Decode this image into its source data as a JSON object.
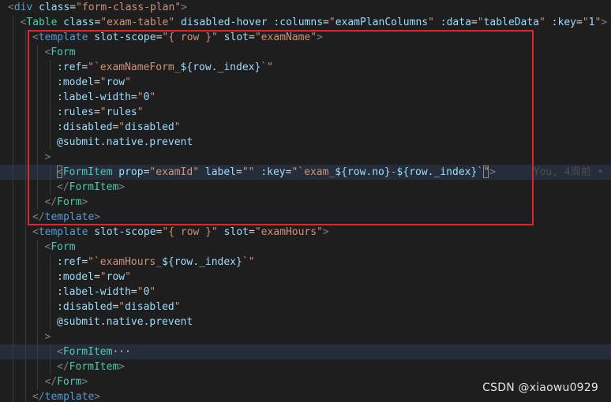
{
  "editor": {
    "theme": {
      "background": "#1e1e1e",
      "current_line": "#262d3a",
      "html_tag": "#569cd6",
      "component_tag": "#4ec9b0",
      "attribute": "#9cdcfe",
      "string": "#ce9178",
      "punctuation": "#808080",
      "highlight_box": "#e0262d"
    },
    "lines": [
      {
        "indent": 0,
        "tokens": [
          [
            "tag-bracket",
            "<"
          ],
          [
            "html-tag",
            "div"
          ],
          [
            "eq",
            " "
          ],
          [
            "attr",
            "class"
          ],
          [
            "eq",
            "="
          ],
          [
            "str",
            "\"form-class-plan\""
          ],
          [
            "tag-bracket",
            ">"
          ]
        ]
      },
      {
        "indent": 1,
        "tokens": [
          [
            "tag-bracket",
            "<"
          ],
          [
            "tag",
            "Table"
          ],
          [
            "eq",
            " "
          ],
          [
            "attr",
            "class"
          ],
          [
            "eq",
            "="
          ],
          [
            "str",
            "\"exam-table\""
          ],
          [
            "eq",
            " "
          ],
          [
            "attr",
            "disabled-hover"
          ],
          [
            "eq",
            " "
          ],
          [
            "attr",
            ":columns"
          ],
          [
            "eq",
            "="
          ],
          [
            "str",
            "\""
          ],
          [
            "bind",
            "examPlanColumns"
          ],
          [
            "str",
            "\""
          ],
          [
            "eq",
            " "
          ],
          [
            "attr",
            ":data"
          ],
          [
            "eq",
            "="
          ],
          [
            "str",
            "\""
          ],
          [
            "bind",
            "tableData"
          ],
          [
            "str",
            "\""
          ],
          [
            "eq",
            " "
          ],
          [
            "attr",
            ":key"
          ],
          [
            "eq",
            "="
          ],
          [
            "str",
            "\""
          ],
          [
            "bind",
            "1"
          ],
          [
            "str",
            "\""
          ],
          [
            "tag-bracket",
            ">"
          ]
        ]
      },
      {
        "indent": 2,
        "tokens": [
          [
            "tag-bracket",
            "<"
          ],
          [
            "html-tag",
            "template"
          ],
          [
            "eq",
            " "
          ],
          [
            "attr",
            "slot-scope"
          ],
          [
            "eq",
            "="
          ],
          [
            "str",
            "\"{ row }\""
          ],
          [
            "eq",
            " "
          ],
          [
            "attr",
            "slot"
          ],
          [
            "eq",
            "="
          ],
          [
            "str",
            "\"examName\""
          ],
          [
            "tag-bracket",
            ">"
          ]
        ]
      },
      {
        "indent": 3,
        "tokens": [
          [
            "tag-bracket",
            "<"
          ],
          [
            "tag",
            "Form"
          ]
        ]
      },
      {
        "indent": 4,
        "tokens": [
          [
            "attr",
            ":ref"
          ],
          [
            "eq",
            "="
          ],
          [
            "str",
            "\"`"
          ],
          [
            "str",
            "examNameForm_"
          ],
          [
            "bind",
            "${row._index}"
          ],
          [
            "str",
            "`\""
          ]
        ]
      },
      {
        "indent": 4,
        "tokens": [
          [
            "attr",
            ":model"
          ],
          [
            "eq",
            "="
          ],
          [
            "str",
            "\""
          ],
          [
            "bind",
            "row"
          ],
          [
            "str",
            "\""
          ]
        ]
      },
      {
        "indent": 4,
        "tokens": [
          [
            "attr",
            ":label-width"
          ],
          [
            "eq",
            "="
          ],
          [
            "str",
            "\""
          ],
          [
            "bind",
            "0"
          ],
          [
            "str",
            "\""
          ]
        ]
      },
      {
        "indent": 4,
        "tokens": [
          [
            "attr",
            ":rules"
          ],
          [
            "eq",
            "="
          ],
          [
            "str",
            "\""
          ],
          [
            "bind",
            "rules"
          ],
          [
            "str",
            "\""
          ]
        ]
      },
      {
        "indent": 4,
        "tokens": [
          [
            "attr",
            ":disabled"
          ],
          [
            "eq",
            "="
          ],
          [
            "str",
            "\""
          ],
          [
            "bind",
            "disabled"
          ],
          [
            "str",
            "\""
          ]
        ]
      },
      {
        "indent": 4,
        "tokens": [
          [
            "attr",
            "@submit.native.prevent"
          ]
        ]
      },
      {
        "indent": 3,
        "tokens": [
          [
            "tag-bracket",
            ">"
          ]
        ]
      },
      {
        "indent": 4,
        "current": true,
        "tokens": [
          [
            "tag-bracket",
            "<"
          ],
          [
            "tag",
            "FormItem"
          ],
          [
            "eq",
            " "
          ],
          [
            "attr",
            "prop"
          ],
          [
            "eq",
            "="
          ],
          [
            "str",
            "\"examId\""
          ],
          [
            "eq",
            " "
          ],
          [
            "attr",
            "label"
          ],
          [
            "eq",
            "="
          ],
          [
            "str",
            "\"\""
          ],
          [
            "eq",
            " "
          ],
          [
            "attr",
            ":key"
          ],
          [
            "eq",
            "="
          ],
          [
            "str",
            "\"`"
          ],
          [
            "str",
            "exam_"
          ],
          [
            "bind",
            "${row.no}"
          ],
          [
            "str",
            "-"
          ],
          [
            "bind",
            "${row._index}"
          ],
          [
            "str",
            "`\""
          ],
          [
            "tag-bracket",
            ">"
          ]
        ],
        "blame": "You, 4周前 • f"
      },
      {
        "indent": 4,
        "tokens": [
          [
            "tag-bracket",
            "</"
          ],
          [
            "tag",
            "FormItem"
          ],
          [
            "tag-bracket",
            ">"
          ]
        ]
      },
      {
        "indent": 3,
        "tokens": [
          [
            "tag-bracket",
            "</"
          ],
          [
            "tag",
            "Form"
          ],
          [
            "tag-bracket",
            ">"
          ]
        ]
      },
      {
        "indent": 2,
        "tokens": [
          [
            "tag-bracket",
            "</"
          ],
          [
            "html-tag",
            "template"
          ],
          [
            "tag-bracket",
            ">"
          ]
        ]
      },
      {
        "indent": 2,
        "tokens": [
          [
            "tag-bracket",
            "<"
          ],
          [
            "html-tag",
            "template"
          ],
          [
            "eq",
            " "
          ],
          [
            "attr",
            "slot-scope"
          ],
          [
            "eq",
            "="
          ],
          [
            "str",
            "\"{ row }\""
          ],
          [
            "eq",
            " "
          ],
          [
            "attr",
            "slot"
          ],
          [
            "eq",
            "="
          ],
          [
            "str",
            "\"examHours\""
          ],
          [
            "tag-bracket",
            ">"
          ]
        ]
      },
      {
        "indent": 3,
        "tokens": [
          [
            "tag-bracket",
            "<"
          ],
          [
            "tag",
            "Form"
          ]
        ]
      },
      {
        "indent": 4,
        "tokens": [
          [
            "attr",
            ":ref"
          ],
          [
            "eq",
            "="
          ],
          [
            "str",
            "\"`"
          ],
          [
            "str",
            "examHours_"
          ],
          [
            "bind",
            "${row._index}"
          ],
          [
            "str",
            "`\""
          ]
        ]
      },
      {
        "indent": 4,
        "tokens": [
          [
            "attr",
            ":model"
          ],
          [
            "eq",
            "="
          ],
          [
            "str",
            "\""
          ],
          [
            "bind",
            "row"
          ],
          [
            "str",
            "\""
          ]
        ]
      },
      {
        "indent": 4,
        "tokens": [
          [
            "attr",
            ":label-width"
          ],
          [
            "eq",
            "="
          ],
          [
            "str",
            "\""
          ],
          [
            "bind",
            "0"
          ],
          [
            "str",
            "\""
          ]
        ]
      },
      {
        "indent": 4,
        "tokens": [
          [
            "attr",
            ":disabled"
          ],
          [
            "eq",
            "="
          ],
          [
            "str",
            "\""
          ],
          [
            "bind",
            "disabled"
          ],
          [
            "str",
            "\""
          ]
        ]
      },
      {
        "indent": 4,
        "tokens": [
          [
            "attr",
            "@submit.native.prevent"
          ]
        ]
      },
      {
        "indent": 3,
        "tokens": [
          [
            "tag-bracket",
            ">"
          ]
        ]
      },
      {
        "indent": 4,
        "current": true,
        "tokens": [
          [
            "tag-bracket",
            "<"
          ],
          [
            "tag",
            "FormItem"
          ],
          [
            "fold",
            "···"
          ]
        ]
      },
      {
        "indent": 4,
        "tokens": [
          [
            "tag-bracket",
            "</"
          ],
          [
            "tag",
            "FormItem"
          ],
          [
            "tag-bracket",
            ">"
          ]
        ]
      },
      {
        "indent": 3,
        "tokens": [
          [
            "tag-bracket",
            "</"
          ],
          [
            "tag",
            "Form"
          ],
          [
            "tag-bracket",
            ">"
          ]
        ]
      },
      {
        "indent": 2,
        "tokens": [
          [
            "tag-bracket",
            "</"
          ],
          [
            "html-tag",
            "template"
          ],
          [
            "tag-bracket",
            ">"
          ]
        ]
      }
    ]
  },
  "watermark": "CSDN @xiaowu0929"
}
